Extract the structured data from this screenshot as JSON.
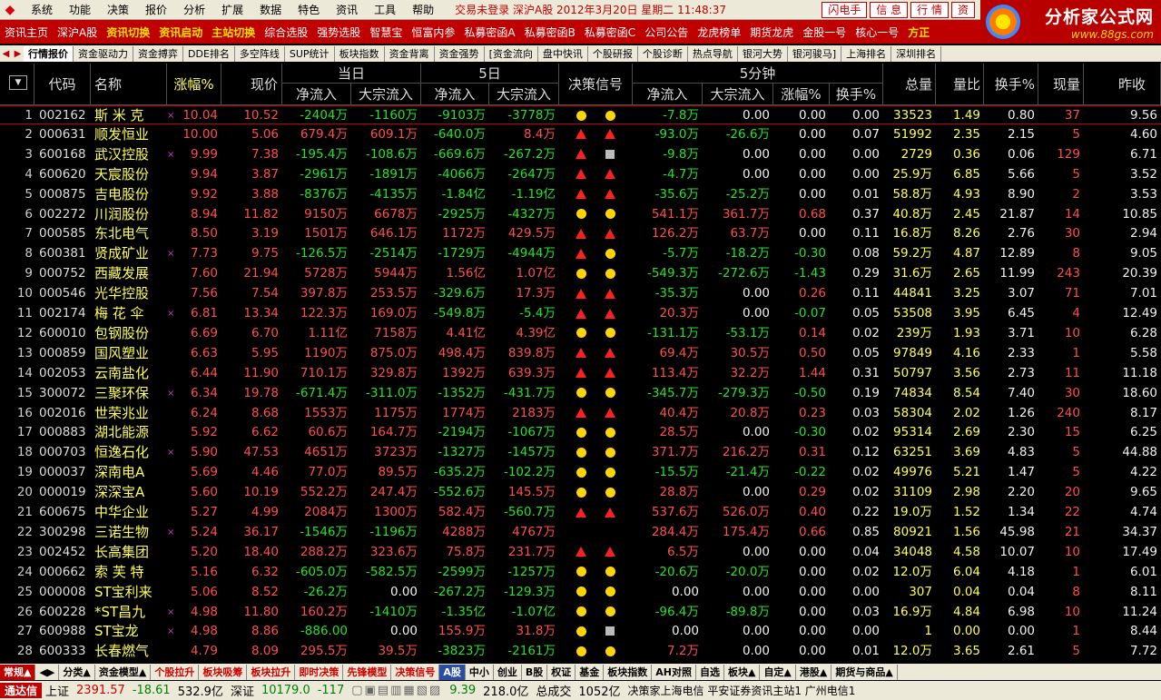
{
  "menubar": {
    "items": [
      "系统",
      "功能",
      "决策",
      "报价",
      "分析",
      "扩展",
      "数据",
      "特色",
      "资讯",
      "工具",
      "帮助"
    ],
    "status": "交易未登录 深沪A股 2012年3月20日 星期二 11:48:37",
    "buttons": [
      "闪电手",
      "信 息",
      "行 情",
      "资"
    ]
  },
  "brand": {
    "title": "分析家公式网",
    "url": "www.88gs.com"
  },
  "toolbar": {
    "items": [
      {
        "label": "资讯主页",
        "hl": false
      },
      {
        "label": "深沪A股",
        "hl": false
      },
      {
        "label": "资讯切换",
        "hl": true
      },
      {
        "label": "资讯启动",
        "hl": true
      },
      {
        "label": "主站切换",
        "hl": true
      },
      {
        "label": "综合选股",
        "hl": false
      },
      {
        "label": "强势选股",
        "hl": false
      },
      {
        "label": "智慧宝",
        "hl": false
      },
      {
        "label": "恒富内参",
        "hl": false
      },
      {
        "label": "私募密函A",
        "hl": false
      },
      {
        "label": "私募密函B",
        "hl": false
      },
      {
        "label": "私募密函C",
        "hl": false
      },
      {
        "label": "公司公告",
        "hl": false
      },
      {
        "label": "龙虎榜单",
        "hl": false
      },
      {
        "label": "期货龙虎",
        "hl": false
      },
      {
        "label": "金股一号",
        "hl": false
      },
      {
        "label": "核心一号",
        "hl": false
      },
      {
        "label": "方正",
        "hl": true
      }
    ]
  },
  "tabs": {
    "items": [
      {
        "label": "行情报价",
        "active": true
      },
      {
        "label": "资金驱动力",
        "active": false
      },
      {
        "label": "资金搏弈",
        "active": false
      },
      {
        "label": "DDE排名",
        "active": false
      },
      {
        "label": "多空阵线",
        "active": false
      },
      {
        "label": "SUP统计",
        "active": false
      },
      {
        "label": "板块指数",
        "active": false
      },
      {
        "label": "资金背离",
        "active": false
      },
      {
        "label": "资金强势",
        "active": false
      },
      {
        "label": "[资金流向",
        "active": false
      },
      {
        "label": "盘中快讯",
        "active": false
      },
      {
        "label": "个股研报",
        "active": false
      },
      {
        "label": "个股诊断",
        "active": false
      },
      {
        "label": "热点导航",
        "active": false
      },
      {
        "label": "银河大势",
        "active": false
      },
      {
        "label": "银河骏马]",
        "active": false
      },
      {
        "label": "上海排名",
        "active": false
      },
      {
        "label": "深圳排名",
        "active": false
      }
    ]
  },
  "header": {
    "sort": "▼",
    "code": "代码",
    "name": "名称",
    "change": "涨幅%",
    "price": "现价",
    "today": "当日",
    "day5": "5日",
    "net_in": "净流入",
    "big_in": "大宗流入",
    "signal": "决策信号",
    "min5": "5分钟",
    "chg": "涨幅%",
    "turn": "换手%",
    "vol": "总量",
    "ratio": "量比",
    "turnover": "换手%",
    "curvol": "现量",
    "prev": "昨收"
  },
  "rows": [
    {
      "i": "1",
      "code": "002162",
      "name": "斯 米 克",
      "mark": "×",
      "chg": "10.04",
      "price": "10.52",
      "tn": "-2404万",
      "tb": "-1160万",
      "fn": "-9103万",
      "fb": "-3778万",
      "s1": "dot",
      "s2": "dot",
      "mn": "-7.8万",
      "mb": "0.00",
      "mc": "0.00",
      "mt": "0.00",
      "vol": "33523",
      "ratio": "1.49",
      "turn": "0.80",
      "cv": "37",
      "prev": "9.56"
    },
    {
      "i": "2",
      "code": "000631",
      "name": "顺发恒业",
      "mark": "",
      "chg": "10.00",
      "price": "5.06",
      "tn": "679.4万",
      "tb": "609.1万",
      "fn": "-640.0万",
      "fb": "8.4万",
      "s1": "tri",
      "s2": "tri",
      "mn": "-93.0万",
      "mb": "-26.6万",
      "mc": "0.00",
      "mt": "0.07",
      "vol": "51992",
      "ratio": "2.35",
      "turn": "2.15",
      "cv": "5",
      "prev": "4.60"
    },
    {
      "i": "3",
      "code": "600168",
      "name": "武汉控股",
      "mark": "×",
      "chg": "9.99",
      "price": "7.38",
      "tn": "-195.4万",
      "tb": "-108.6万",
      "fn": "-669.6万",
      "fb": "-267.2万",
      "s1": "tri",
      "s2": "sq",
      "mn": "-9.8万",
      "mb": "0.00",
      "mc": "0.00",
      "mt": "0.00",
      "vol": "2729",
      "ratio": "0.36",
      "turn": "0.06",
      "cv": "129",
      "prev": "6.71"
    },
    {
      "i": "4",
      "code": "600620",
      "name": "天宸股份",
      "mark": "",
      "chg": "9.94",
      "price": "3.87",
      "tn": "-2961万",
      "tb": "-1891万",
      "fn": "-4066万",
      "fb": "-2647万",
      "s1": "tri",
      "s2": "tri",
      "mn": "-4.7万",
      "mb": "0.00",
      "mc": "0.00",
      "mt": "0.00",
      "vol": "25.9万",
      "ratio": "6.85",
      "turn": "5.66",
      "cv": "5",
      "prev": "3.52"
    },
    {
      "i": "5",
      "code": "000875",
      "name": "吉电股份",
      "mark": "",
      "chg": "9.92",
      "price": "3.88",
      "tn": "-8376万",
      "tb": "-4135万",
      "fn": "-1.84亿",
      "fb": "-1.19亿",
      "s1": "tri",
      "s2": "tri",
      "mn": "-35.6万",
      "mb": "-25.2万",
      "mc": "0.00",
      "mt": "0.01",
      "vol": "58.8万",
      "ratio": "4.93",
      "turn": "8.90",
      "cv": "2",
      "prev": "3.53"
    },
    {
      "i": "6",
      "code": "002272",
      "name": "川润股份",
      "mark": "",
      "chg": "8.94",
      "price": "11.82",
      "tn": "9150万",
      "tb": "6678万",
      "fn": "-2925万",
      "fb": "-4327万",
      "s1": "dot",
      "s2": "dot",
      "mn": "541.1万",
      "mb": "361.7万",
      "mc": "0.68",
      "mt": "0.37",
      "vol": "40.8万",
      "ratio": "2.45",
      "turn": "21.87",
      "cv": "14",
      "prev": "10.85"
    },
    {
      "i": "7",
      "code": "000585",
      "name": "东北电气",
      "mark": "",
      "chg": "8.50",
      "price": "3.19",
      "tn": "1501万",
      "tb": "646.1万",
      "fn": "1172万",
      "fb": "429.5万",
      "s1": "tri",
      "s2": "tri",
      "mn": "126.2万",
      "mb": "63.7万",
      "mc": "0.00",
      "mt": "0.11",
      "vol": "16.8万",
      "ratio": "8.26",
      "turn": "2.76",
      "cv": "30",
      "prev": "2.94"
    },
    {
      "i": "8",
      "code": "600381",
      "name": "贤成矿业",
      "mark": "×",
      "chg": "7.73",
      "price": "9.75",
      "tn": "-126.5万",
      "tb": "-2514万",
      "fn": "-1729万",
      "fb": "-4944万",
      "s1": "tri",
      "s2": "dot",
      "mn": "-5.7万",
      "mb": "-18.2万",
      "mc": "-0.30",
      "mt": "0.08",
      "vol": "59.2万",
      "ratio": "4.87",
      "turn": "12.89",
      "cv": "8",
      "prev": "9.05"
    },
    {
      "i": "9",
      "code": "000752",
      "name": "西藏发展",
      "mark": "",
      "chg": "7.60",
      "price": "21.94",
      "tn": "5728万",
      "tb": "5944万",
      "fn": "1.56亿",
      "fb": "1.07亿",
      "s1": "dot",
      "s2": "dot",
      "mn": "-549.3万",
      "mb": "-272.6万",
      "mc": "-1.43",
      "mt": "0.29",
      "vol": "31.6万",
      "ratio": "2.65",
      "turn": "11.99",
      "cv": "243",
      "prev": "20.39"
    },
    {
      "i": "10",
      "code": "000546",
      "name": "光华控股",
      "mark": "",
      "chg": "7.56",
      "price": "7.54",
      "tn": "397.8万",
      "tb": "253.5万",
      "fn": "-329.6万",
      "fb": "17.3万",
      "s1": "tri",
      "s2": "tri",
      "mn": "-35.3万",
      "mb": "0.00",
      "mc": "0.26",
      "mt": "0.11",
      "vol": "44841",
      "ratio": "3.25",
      "turn": "3.07",
      "cv": "71",
      "prev": "7.01"
    },
    {
      "i": "11",
      "code": "002174",
      "name": "梅 花 伞",
      "mark": "×",
      "chg": "6.81",
      "price": "13.34",
      "tn": "122.3万",
      "tb": "169.0万",
      "fn": "-549.8万",
      "fb": "-5.4万",
      "s1": "tri",
      "s2": "tri",
      "mn": "20.3万",
      "mb": "0.00",
      "mc": "-0.07",
      "mt": "0.05",
      "vol": "53508",
      "ratio": "3.95",
      "turn": "6.45",
      "cv": "4",
      "prev": "12.49"
    },
    {
      "i": "12",
      "code": "600010",
      "name": "包钢股份",
      "mark": "",
      "chg": "6.69",
      "price": "6.70",
      "tn": "1.11亿",
      "tb": "7158万",
      "fn": "4.41亿",
      "fb": "4.39亿",
      "s1": "dot",
      "s2": "dot",
      "mn": "-131.1万",
      "mb": "-53.1万",
      "mc": "0.14",
      "mt": "0.02",
      "vol": "239万",
      "ratio": "1.93",
      "turn": "3.71",
      "cv": "10",
      "prev": "6.28"
    },
    {
      "i": "13",
      "code": "000859",
      "name": "国风塑业",
      "mark": "",
      "chg": "6.63",
      "price": "5.95",
      "tn": "1190万",
      "tb": "875.0万",
      "fn": "498.4万",
      "fb": "839.8万",
      "s1": "tri",
      "s2": "tri",
      "mn": "69.4万",
      "mb": "30.5万",
      "mc": "0.50",
      "mt": "0.05",
      "vol": "97849",
      "ratio": "4.16",
      "turn": "2.33",
      "cv": "1",
      "prev": "5.58"
    },
    {
      "i": "14",
      "code": "002053",
      "name": "云南盐化",
      "mark": "",
      "chg": "6.44",
      "price": "11.90",
      "tn": "710.1万",
      "tb": "329.8万",
      "fn": "1392万",
      "fb": "639.3万",
      "s1": "tri",
      "s2": "tri",
      "mn": "113.4万",
      "mb": "32.2万",
      "mc": "1.44",
      "mt": "0.31",
      "vol": "50797",
      "ratio": "3.56",
      "turn": "2.73",
      "cv": "11",
      "prev": "11.18"
    },
    {
      "i": "15",
      "code": "300072",
      "name": "三聚环保",
      "mark": "×",
      "chg": "6.34",
      "price": "19.78",
      "tn": "-671.4万",
      "tb": "-311.0万",
      "fn": "-1352万",
      "fb": "-431.7万",
      "s1": "dot",
      "s2": "dot",
      "mn": "-345.7万",
      "mb": "-279.3万",
      "mc": "-0.50",
      "mt": "0.19",
      "vol": "74834",
      "ratio": "8.54",
      "turn": "7.40",
      "cv": "30",
      "prev": "18.60"
    },
    {
      "i": "16",
      "code": "002016",
      "name": "世荣兆业",
      "mark": "",
      "chg": "6.24",
      "price": "8.68",
      "tn": "1553万",
      "tb": "1175万",
      "fn": "1774万",
      "fb": "2183万",
      "s1": "tri",
      "s2": "tri",
      "mn": "40.4万",
      "mb": "20.8万",
      "mc": "0.23",
      "mt": "0.03",
      "vol": "58304",
      "ratio": "2.02",
      "turn": "1.26",
      "cv": "240",
      "prev": "8.17"
    },
    {
      "i": "17",
      "code": "000883",
      "name": "湖北能源",
      "mark": "",
      "chg": "5.92",
      "price": "6.62",
      "tn": "60.6万",
      "tb": "164.7万",
      "fn": "-2194万",
      "fb": "-1067万",
      "s1": "dot",
      "s2": "dot",
      "mn": "28.5万",
      "mb": "0.00",
      "mc": "-0.30",
      "mt": "0.02",
      "vol": "95314",
      "ratio": "2.69",
      "turn": "2.30",
      "cv": "15",
      "prev": "6.25"
    },
    {
      "i": "18",
      "code": "000703",
      "name": "恒逸石化",
      "mark": "×",
      "chg": "5.90",
      "price": "47.53",
      "tn": "4651万",
      "tb": "3723万",
      "fn": "-1327万",
      "fb": "-1457万",
      "s1": "dot",
      "s2": "dot",
      "mn": "371.7万",
      "mb": "216.2万",
      "mc": "0.31",
      "mt": "0.12",
      "vol": "63251",
      "ratio": "3.69",
      "turn": "4.83",
      "cv": "5",
      "prev": "44.88"
    },
    {
      "i": "19",
      "code": "000037",
      "name": "深南电A",
      "mark": "",
      "chg": "5.69",
      "price": "4.46",
      "tn": "77.0万",
      "tb": "89.5万",
      "fn": "-635.2万",
      "fb": "-102.2万",
      "s1": "dot",
      "s2": "dot",
      "mn": "-15.5万",
      "mb": "-21.4万",
      "mc": "-0.22",
      "mt": "0.02",
      "vol": "49976",
      "ratio": "5.21",
      "turn": "1.47",
      "cv": "5",
      "prev": "4.22"
    },
    {
      "i": "20",
      "code": "000019",
      "name": "深深宝A",
      "mark": "",
      "chg": "5.60",
      "price": "10.19",
      "tn": "552.2万",
      "tb": "247.4万",
      "fn": "-552.6万",
      "fb": "145.5万",
      "s1": "dot",
      "s2": "dot",
      "mn": "28.8万",
      "mb": "0.00",
      "mc": "0.29",
      "mt": "0.02",
      "vol": "31109",
      "ratio": "2.98",
      "turn": "2.20",
      "cv": "20",
      "prev": "9.65"
    },
    {
      "i": "21",
      "code": "600675",
      "name": "中华企业",
      "mark": "",
      "chg": "5.27",
      "price": "4.99",
      "tn": "2084万",
      "tb": "1300万",
      "fn": "582.4万",
      "fb": "-560.7万",
      "s1": "tri",
      "s2": "tri",
      "mn": "537.6万",
      "mb": "526.0万",
      "mc": "0.40",
      "mt": "0.22",
      "vol": "19.0万",
      "ratio": "1.52",
      "turn": "1.34",
      "cv": "22",
      "prev": "4.74"
    },
    {
      "i": "22",
      "code": "300298",
      "name": "三诺生物",
      "mark": "×",
      "chg": "5.24",
      "price": "36.17",
      "tn": "-1546万",
      "tb": "-1196万",
      "fn": "4288万",
      "fb": "4767万",
      "s1": "",
      "s2": "",
      "mn": "284.4万",
      "mb": "175.4万",
      "mc": "0.66",
      "mt": "0.85",
      "vol": "80921",
      "ratio": "1.56",
      "turn": "45.98",
      "cv": "21",
      "prev": "34.37"
    },
    {
      "i": "23",
      "code": "002452",
      "name": "长高集团",
      "mark": "",
      "chg": "5.20",
      "price": "18.40",
      "tn": "288.2万",
      "tb": "323.6万",
      "fn": "75.8万",
      "fb": "231.7万",
      "s1": "tri",
      "s2": "tri",
      "mn": "6.5万",
      "mb": "0.00",
      "mc": "0.00",
      "mt": "0.04",
      "vol": "34048",
      "ratio": "4.58",
      "turn": "10.07",
      "cv": "10",
      "prev": "17.49"
    },
    {
      "i": "24",
      "code": "000662",
      "name": "索 芙 特",
      "mark": "",
      "chg": "5.16",
      "price": "6.32",
      "tn": "-605.0万",
      "tb": "-582.5万",
      "fn": "-2599万",
      "fb": "-1257万",
      "s1": "dot",
      "s2": "dot",
      "mn": "-20.6万",
      "mb": "-20.0万",
      "mc": "0.00",
      "mt": "0.02",
      "vol": "12.0万",
      "ratio": "6.04",
      "turn": "4.18",
      "cv": "1",
      "prev": "6.01"
    },
    {
      "i": "25",
      "code": "000008",
      "name": "ST宝利来",
      "mark": "",
      "chg": "5.06",
      "price": "8.52",
      "tn": "-26.2万",
      "tb": "0.00",
      "fn": "-267.2万",
      "fb": "-129.3万",
      "s1": "dot",
      "s2": "dot",
      "mn": "0.00",
      "mb": "0.00",
      "mc": "0.00",
      "mt": "0.00",
      "vol": "307",
      "ratio": "0.04",
      "turn": "0.04",
      "cv": "8",
      "prev": "8.11"
    },
    {
      "i": "26",
      "code": "600228",
      "name": "*ST昌九",
      "mark": "×",
      "chg": "4.98",
      "price": "11.80",
      "tn": "160.2万",
      "tb": "-1410万",
      "fn": "-1.35亿",
      "fb": "-1.07亿",
      "s1": "dot",
      "s2": "dot",
      "mn": "-96.4万",
      "mb": "-89.8万",
      "mc": "0.00",
      "mt": "0.03",
      "vol": "16.9万",
      "ratio": "4.84",
      "turn": "6.98",
      "cv": "10",
      "prev": "11.24"
    },
    {
      "i": "27",
      "code": "600988",
      "name": "ST宝龙",
      "mark": "×",
      "chg": "4.98",
      "price": "8.86",
      "tn": "-886.00",
      "tb": "0.00",
      "fn": "155.9万",
      "fb": "31.8万",
      "s1": "dot",
      "s2": "sq",
      "mn": "0.00",
      "mb": "0.00",
      "mc": "0.00",
      "mt": "0.00",
      "vol": "1",
      "ratio": "0.00",
      "turn": "0.00",
      "cv": "1",
      "prev": "8.44"
    },
    {
      "i": "28",
      "code": "600333",
      "name": "长春燃气",
      "mark": "",
      "chg": "4.79",
      "price": "8.09",
      "tn": "295.5万",
      "tb": "39.5万",
      "fn": "-3823万",
      "fb": "-2161万",
      "s1": "dot",
      "s2": "dot",
      "mn": "7.2万",
      "mb": "0.00",
      "mc": "0.00",
      "mt": "0.01",
      "vol": "12.0万",
      "ratio": "3.65",
      "turn": "2.61",
      "cv": "5",
      "prev": "7.72"
    }
  ],
  "bottomtabs": {
    "items": [
      {
        "label": "常规▲",
        "style": "red"
      },
      {
        "label": "◀▶",
        "style": ""
      },
      {
        "label": "分类▲",
        "style": ""
      },
      {
        "label": "资金模型▲",
        "style": ""
      },
      {
        "label": "个股拉升",
        "style": "rt"
      },
      {
        "label": "板块吸筹",
        "style": "rt"
      },
      {
        "label": "板块拉升",
        "style": "rt"
      },
      {
        "label": "即时决策",
        "style": "rt"
      },
      {
        "label": "先锋模型",
        "style": "rt"
      },
      {
        "label": "决策信号",
        "style": "rt"
      },
      {
        "label": "A股",
        "style": "blue"
      },
      {
        "label": "中小",
        "style": ""
      },
      {
        "label": "创业",
        "style": ""
      },
      {
        "label": "B股",
        "style": ""
      },
      {
        "label": "权证",
        "style": ""
      },
      {
        "label": "基金",
        "style": ""
      },
      {
        "label": "板块指数",
        "style": ""
      },
      {
        "label": "AH对照",
        "style": ""
      },
      {
        "label": "自选",
        "style": ""
      },
      {
        "label": "板块▲",
        "style": ""
      },
      {
        "label": "自定▲",
        "style": ""
      },
      {
        "label": "港股▲",
        "style": ""
      },
      {
        "label": "期货与商品▲",
        "style": ""
      }
    ]
  },
  "statusbar": {
    "tdx": "通达信",
    "sh_label": "上证",
    "sh_val": "2391.57",
    "sh_chg": "-18.61",
    "sh_amt": "532.9亿",
    "sz_label": "深证",
    "sz_val": "10179.0",
    "sz_chg": "-117",
    "tool_val": "9.39",
    "tool_amt": "218.0亿",
    "total_label": "总成交",
    "total_val": "1052亿",
    "info": "决策家上海电信 平安证券资讯主站1 广州电信1"
  }
}
